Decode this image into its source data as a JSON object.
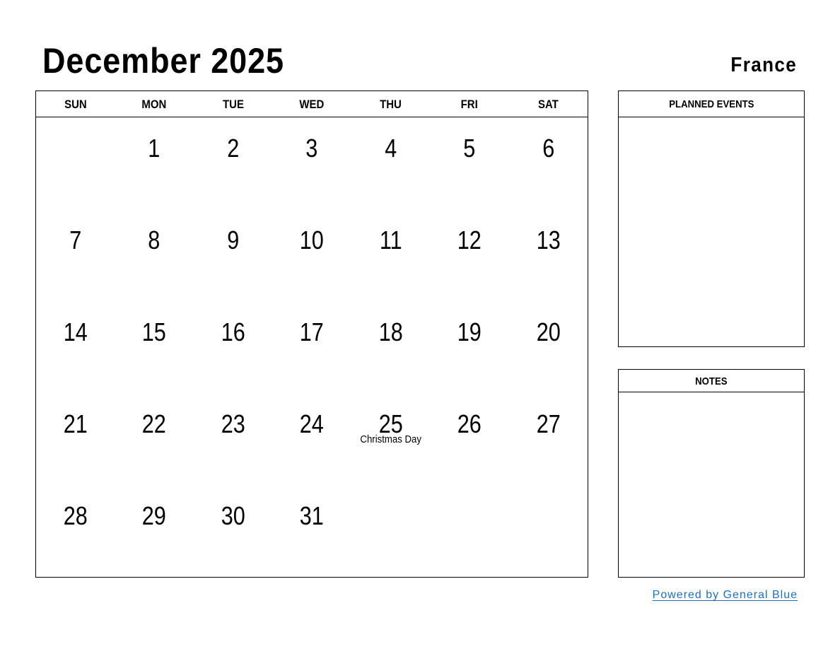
{
  "header": {
    "title": "December 2025",
    "country": "France"
  },
  "calendar": {
    "weekdays": [
      "SUN",
      "MON",
      "TUE",
      "WED",
      "THU",
      "FRI",
      "SAT"
    ],
    "weeks": [
      [
        {
          "day": ""
        },
        {
          "day": "1"
        },
        {
          "day": "2"
        },
        {
          "day": "3"
        },
        {
          "day": "4"
        },
        {
          "day": "5"
        },
        {
          "day": "6"
        }
      ],
      [
        {
          "day": "7"
        },
        {
          "day": "8"
        },
        {
          "day": "9"
        },
        {
          "day": "10"
        },
        {
          "day": "11"
        },
        {
          "day": "12"
        },
        {
          "day": "13"
        }
      ],
      [
        {
          "day": "14"
        },
        {
          "day": "15"
        },
        {
          "day": "16"
        },
        {
          "day": "17"
        },
        {
          "day": "18"
        },
        {
          "day": "19"
        },
        {
          "day": "20"
        }
      ],
      [
        {
          "day": "21"
        },
        {
          "day": "22"
        },
        {
          "day": "23"
        },
        {
          "day": "24"
        },
        {
          "day": "25",
          "holiday": "Christmas Day"
        },
        {
          "day": "26"
        },
        {
          "day": "27"
        }
      ],
      [
        {
          "day": "28"
        },
        {
          "day": "29"
        },
        {
          "day": "30"
        },
        {
          "day": "31"
        },
        {
          "day": ""
        },
        {
          "day": ""
        },
        {
          "day": ""
        }
      ]
    ]
  },
  "panels": {
    "planned_events": "PLANNED EVENTS",
    "notes": "NOTES"
  },
  "footer": {
    "link_text": "Powered by General Blue",
    "link_color": "#1f6fbf"
  }
}
